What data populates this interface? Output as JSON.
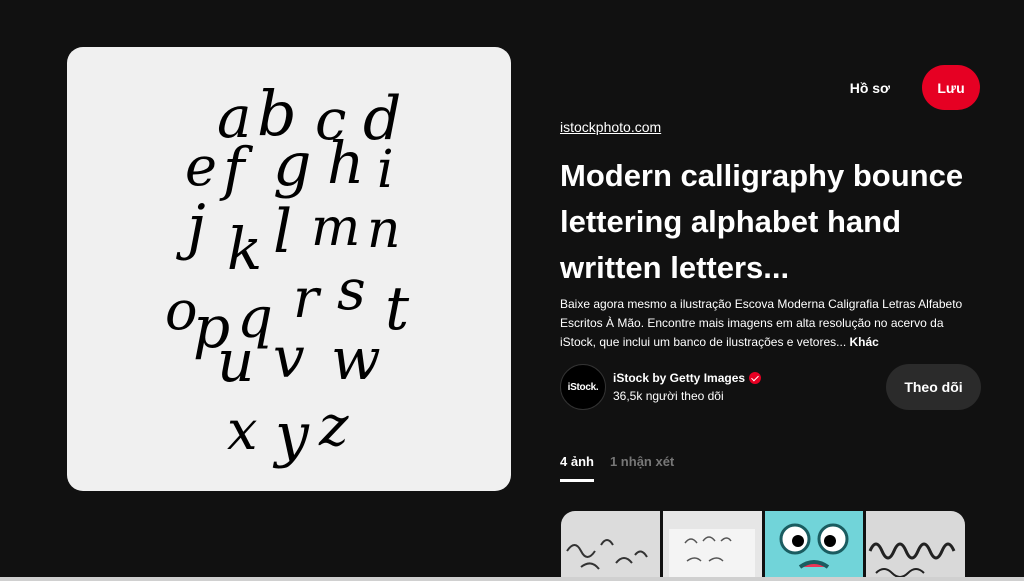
{
  "header": {
    "profile_label": "Hồ sơ",
    "save_label": "Lưu"
  },
  "pin": {
    "image_letters": [
      "a",
      "b",
      "c",
      "d",
      "e",
      "f",
      "g",
      "h",
      "i",
      "j",
      "k",
      "l",
      "m",
      "n",
      "o",
      "p",
      "q",
      "r",
      "s",
      "t",
      "u",
      "v",
      "w",
      "x",
      "y",
      "z"
    ],
    "source": "istockphoto.com",
    "title": "Modern calligraphy bounce lettering alphabet hand written letters...",
    "description": "Baixe agora mesmo a ilustração Escova Moderna Caligrafia Letras Alfabeto Escritos À Mão. Encontre mais imagens em alta resolução no acervo da iStock, que inclui um banco de ilustrações e vetores...",
    "more_label": "Khác"
  },
  "creator": {
    "avatar_text": "iStock.",
    "name": "iStock by Getty Images",
    "followers": "36,5k người theo dõi",
    "follow_label": "Theo dõi"
  },
  "tabs": [
    {
      "label": "4 ảnh",
      "active": true
    },
    {
      "label": "1 nhận xét",
      "active": false
    }
  ],
  "colors": {
    "background": "#111111",
    "accent": "#e60023",
    "verified": "#e60023"
  }
}
